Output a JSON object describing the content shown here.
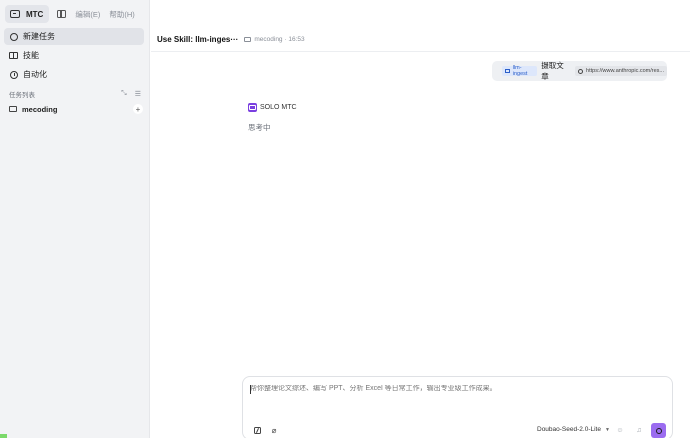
{
  "app": {
    "name": "MTC"
  },
  "menu": {
    "items": [
      "编辑(E)",
      "帮助(H)"
    ]
  },
  "sidebar": {
    "nav": [
      {
        "label": "新建任务",
        "icon": "new-chat-icon",
        "active": true
      },
      {
        "label": "技能",
        "icon": "book-icon",
        "active": false
      },
      {
        "label": "自动化",
        "icon": "clock-icon",
        "active": false
      }
    ],
    "tasks_label": "任务列表",
    "tasks": [
      {
        "name": "mecoding"
      }
    ]
  },
  "chat": {
    "title": "Use Skill: llm-inges···",
    "folder": "mecoding",
    "time": "16:53",
    "user_message": {
      "skill_chip": "llm-ingest",
      "text": "摄取文章",
      "link": "https://www.anthropic.com/res..."
    },
    "agent": {
      "name": "SOLO MTC",
      "status": "思考中"
    }
  },
  "composer": {
    "placeholder": "帮你整理论文综述、编写 PPT、分析 Excel 等日常工作，输出专业级工作成果。",
    "model": "Doubao-Seed-2.0-Lite"
  },
  "colors": {
    "accent": "#9b6cf0",
    "agent_avatar": "#7a3fe0",
    "skill_chip_bg": "#dde7fb"
  }
}
